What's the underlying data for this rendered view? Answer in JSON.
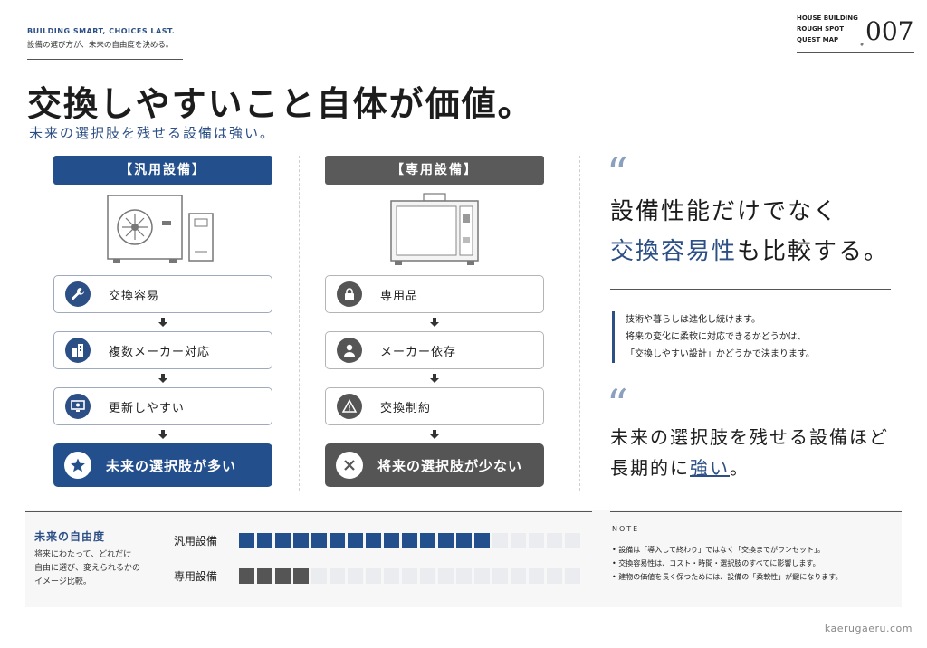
{
  "header": {
    "en_tagline": "BUILDING SMART, CHOICES LAST.",
    "jp_tagline": "設備の選び方が、未来の自由度を決める。",
    "series_lines": [
      "HOUSE BUILDING",
      "ROUGH SPOT",
      "QUEST MAP"
    ],
    "no_label": "#",
    "number": "007"
  },
  "title": "交換しやすいこと自体が価値。",
  "subtitle": "未来の選択肢を残せる設備は強い。",
  "general": {
    "heading": "【汎用設備】",
    "steps": [
      "交換容易",
      "複数メーカー対応",
      "更新しやすい"
    ],
    "result": "未来の選択肢が多い"
  },
  "dedicated": {
    "heading": "【専用設備】",
    "steps": [
      "専用品",
      "メーカー依存",
      "交換制約"
    ],
    "result": "将来の選択肢が少ない"
  },
  "quote1": {
    "line1": "設備性能だけでなく",
    "line2_accent": "交換容易性",
    "line2_rest": "も比較する。"
  },
  "body_lines": [
    "技術や暮らしは進化し続けます。",
    "将来の変化に柔軟に対応できるかどうかは、",
    "「交換しやすい設計」かどうかで決まります。"
  ],
  "quote2": {
    "line1": "未来の選択肢を残せる設備ほど",
    "line2_prefix": "長期的に",
    "line2_accent": "強い",
    "line2_suffix": "。"
  },
  "freedom": {
    "title": "未来の自由度",
    "desc_lines": [
      "将来にわたって、どれだけ",
      "自由に選び、変えられるかの",
      "イメージ比較。"
    ],
    "total_cells": 19,
    "rows": [
      {
        "label": "汎用設備",
        "filled": 14
      },
      {
        "label": "専用設備",
        "filled": 4
      }
    ]
  },
  "note": {
    "title": "NOTE",
    "items": [
      "設備は「導入して終わり」ではなく「交換までがワンセット」。",
      "交換容易性は、コスト・時間・選択肢のすべてに影響します。",
      "建物の価値を長く保つためには、設備の「柔軟性」が鍵になります。"
    ]
  },
  "watermark": "kaerugaeru.com",
  "colors": {
    "accent": "#234f8c",
    "secondary": "#5a5a5a",
    "light": "#ebecef"
  }
}
